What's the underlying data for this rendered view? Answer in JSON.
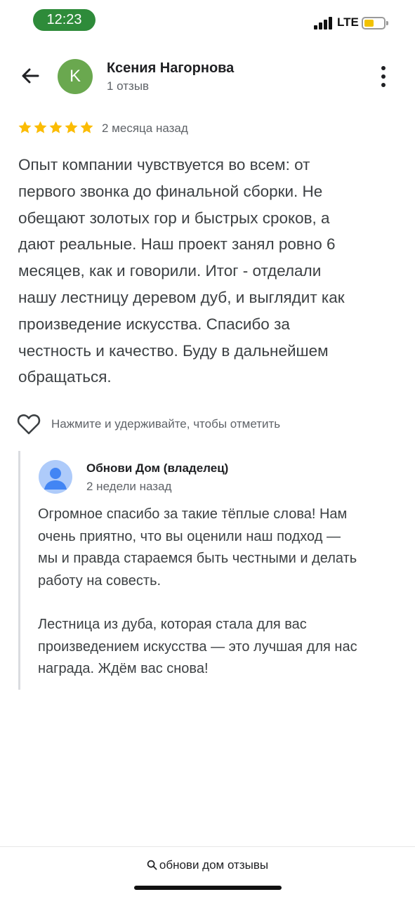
{
  "status_bar": {
    "time": "12:23",
    "network": "LTE",
    "battery_level": 0.5,
    "accent_color": "#2e8b3a"
  },
  "header": {
    "back_icon": "arrow-left-icon",
    "avatar_letter": "K",
    "avatar_color": "#6aa84f",
    "reviewer_name": "Ксения Нагорнова",
    "review_count": "1 отзыв",
    "more_icon": "more-vertical-icon"
  },
  "review": {
    "rating": 5,
    "rating_max": 5,
    "star_color": "#fbbc04",
    "date": "2 месяца назад",
    "lines": [
      "Опыт компании чувствуется во всем: от",
      "первого звонка до финальной сборки. Не",
      "обещают золотых гор и быстрых сроков, а",
      "дают реальные. Наш проект занял ровно 6",
      "месяцев, как и говорили. Итог - отделали",
      "нашу лестницу деревом дуб, и выглядит как",
      "произведение искусства. Спасибо за",
      "честность и качество. Буду в дальнейшем",
      "обращаться."
    ]
  },
  "like": {
    "icon": "heart-outline-icon",
    "label": "Нажмите и удерживайте, чтобы отметить"
  },
  "owner_reply": {
    "avatar_icon": "person-avatar-icon",
    "name": "Обнови Дом (владелец)",
    "date": "2 недели назад",
    "paragraph1": [
      "Огромное спасибо за такие тёплые слова! Нам",
      "очень приятно, что вы оценили наш подход —",
      "мы и правда стараемся быть честными и делать",
      "работу на совесть."
    ],
    "paragraph2": [
      "Лестница из дуба, которая стала для вас",
      "произведением искусства — это лучшая для нас",
      "награда. Ждём вас снова!"
    ]
  },
  "bottom_bar": {
    "search_icon": "search-icon",
    "query": "обнови дом отзывы"
  }
}
